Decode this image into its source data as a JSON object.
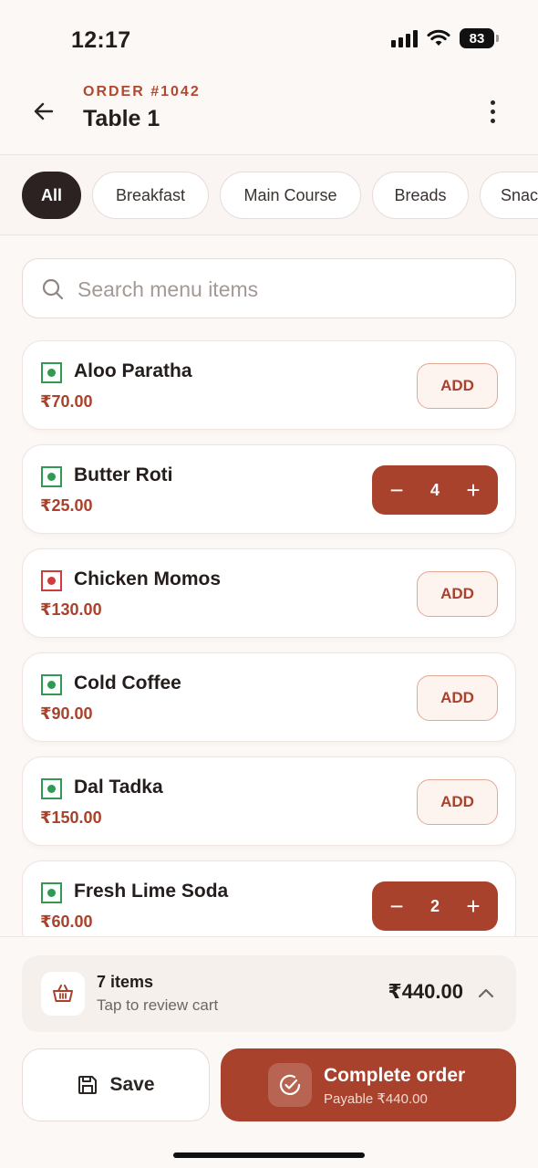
{
  "status_bar": {
    "time": "12:17",
    "battery": "83",
    "icons": [
      "signal-icon",
      "wifi-icon",
      "battery-icon"
    ]
  },
  "header": {
    "order_label": "ORDER #1042",
    "title": "Table 1",
    "back_icon": "arrow-left-icon",
    "more_icon": "more-vertical-icon"
  },
  "categories": {
    "selected": "All",
    "items": [
      "All",
      "Breakfast",
      "Main Course",
      "Breads",
      "Snac"
    ]
  },
  "search": {
    "placeholder": "Search menu items",
    "value": ""
  },
  "menu": {
    "items": [
      {
        "name": "Aloo Paratha",
        "price": "₹70.00",
        "type": "veg",
        "quantity": 0,
        "add_label": "ADD"
      },
      {
        "name": "Butter Roti",
        "price": "₹25.00",
        "type": "veg",
        "quantity": "4",
        "add_label": "ADD"
      },
      {
        "name": "Chicken Momos",
        "price": "₹130.00",
        "type": "non-veg",
        "quantity": 0,
        "add_label": "ADD"
      },
      {
        "name": "Cold Coffee",
        "price": "₹90.00",
        "type": "veg",
        "quantity": 0,
        "add_label": "ADD"
      },
      {
        "name": "Dal Tadka",
        "price": "₹150.00",
        "type": "veg",
        "quantity": 0,
        "add_label": "ADD"
      },
      {
        "name": "Fresh Lime Soda",
        "price": "₹60.00",
        "type": "veg",
        "quantity": "2",
        "add_label": "ADD"
      }
    ]
  },
  "cart": {
    "count_label": "7 items",
    "hint": "Tap to review cart",
    "total": "₹440.00"
  },
  "actions": {
    "save_label": "Save",
    "complete_label": "Complete order",
    "complete_sub": "Payable ₹440.00"
  },
  "colors": {
    "accent": "#a8422c",
    "dark": "#2b2221",
    "veg": "#2e9a52",
    "non_veg": "#d23b3b",
    "background": "#fcf8f6"
  }
}
